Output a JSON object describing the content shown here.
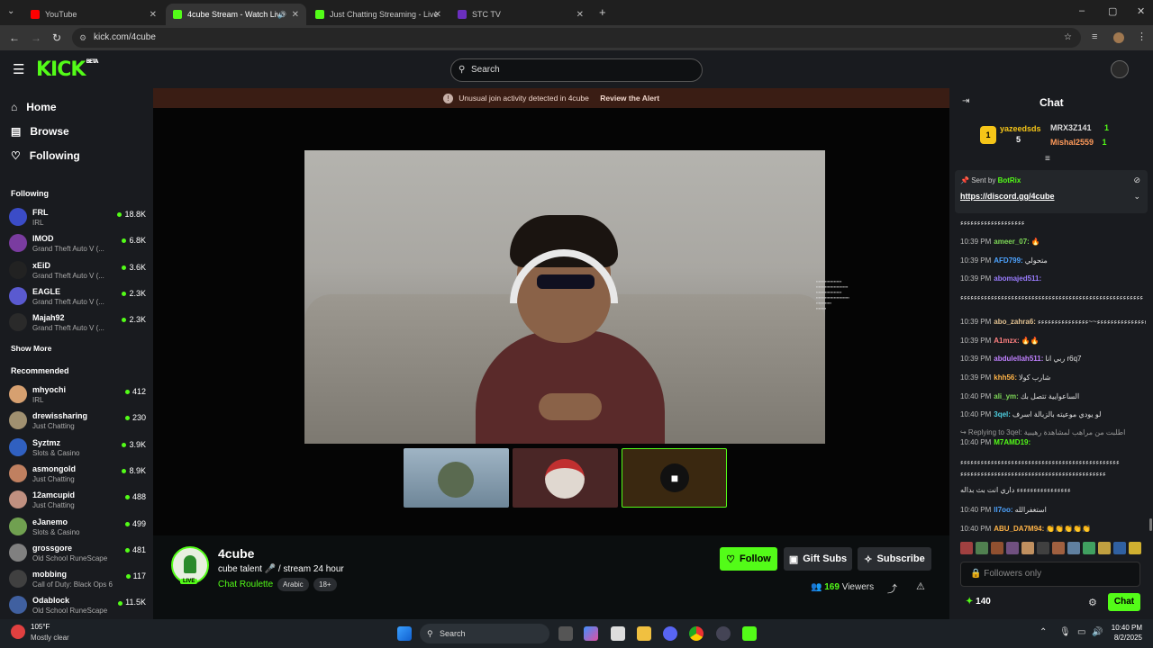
{
  "browser": {
    "tabs": [
      {
        "title": "YouTube",
        "color": "#ff0000"
      },
      {
        "title": "4cube Stream - Watch Live",
        "color": "#53fc18"
      },
      {
        "title": "Just Chatting Streaming - Live",
        "color": "#53fc18"
      },
      {
        "title": "STC TV",
        "color": "#6b2fbf"
      }
    ],
    "url": "kick.com/4cube"
  },
  "header": {
    "logo": "KICK",
    "logo_badge": "BETA",
    "search_placeholder": "Search"
  },
  "sidebar": {
    "nav": [
      "Home",
      "Browse",
      "Following"
    ],
    "following_title": "Following",
    "following": [
      {
        "name": "FRL",
        "category": "IRL",
        "viewers": "18.8K",
        "color": "#3b4cc7"
      },
      {
        "name": "IMOD",
        "category": "Grand Theft Auto V (...",
        "viewers": "6.8K",
        "color": "#7a3ca0"
      },
      {
        "name": "xEiD",
        "category": "Grand Theft Auto V (...",
        "viewers": "3.6K",
        "color": "#222"
      },
      {
        "name": "EAGLE",
        "category": "Grand Theft Auto V (...",
        "viewers": "2.3K",
        "color": "#5a5ad0"
      },
      {
        "name": "Majah92",
        "category": "Grand Theft Auto V (...",
        "viewers": "2.3K",
        "color": "#2a2a2a"
      }
    ],
    "show_more": "Show More",
    "recommended_title": "Recommended",
    "recommended": [
      {
        "name": "mhyochi",
        "category": "IRL",
        "viewers": "412",
        "color": "#d6a070"
      },
      {
        "name": "drewissharing",
        "category": "Just Chatting",
        "viewers": "230",
        "color": "#a09070"
      },
      {
        "name": "Syztmz",
        "category": "Slots & Casino",
        "viewers": "3.9K",
        "color": "#3060c0"
      },
      {
        "name": "asmongold",
        "category": "Just Chatting",
        "viewers": "8.9K",
        "color": "#c08060"
      },
      {
        "name": "12amcupid",
        "category": "Just Chatting",
        "viewers": "488",
        "color": "#c09080"
      },
      {
        "name": "eJanemo",
        "category": "Slots & Casino",
        "viewers": "499",
        "color": "#70a050"
      },
      {
        "name": "grossgore",
        "category": "Old School RuneScape",
        "viewers": "481",
        "color": "#808080"
      },
      {
        "name": "mobbing",
        "category": "Call of Duty: Black Ops 6",
        "viewers": "117",
        "color": "#404040"
      },
      {
        "name": "Odablock",
        "category": "Old School RuneScape",
        "viewers": "11.5K",
        "color": "#4060a0"
      }
    ]
  },
  "alert": {
    "text": "Unusual join activity detected in 4cube",
    "action": "Review the Alert"
  },
  "stream": {
    "channel": "4cube",
    "title": "cube talent 🎤 / stream 24 hour",
    "category": "Chat Roulette",
    "tags": [
      "Arabic",
      "18+"
    ],
    "live_badge": "LIVE",
    "viewers": "169",
    "viewers_label": "Viewers",
    "follow": "Follow",
    "gift": "Gift Subs",
    "subscribe": "Subscribe"
  },
  "chat": {
    "title": "Chat",
    "top_gifter": {
      "name": "yazeedsds",
      "count": "5"
    },
    "leaders": [
      {
        "name": "MRX3Z141",
        "count": "1"
      },
      {
        "name": "Mishal2559",
        "count": "1"
      }
    ],
    "pinned_sender_label": "Sent by",
    "pinned_sender": "BotRix",
    "pinned_link": "https://discord.gg/4cube",
    "messages": [
      {
        "time": "",
        "user": "",
        "text": "ءءءءءءءءءءءءءءءءءءء",
        "color": "#e0e0e0"
      },
      {
        "time": "10:39 PM",
        "user": "ameer_07:",
        "text": "🔥",
        "color": "#7ed957"
      },
      {
        "time": "10:39 PM",
        "user": "AFD799:",
        "text": "متحولي",
        "color": "#4da3ff"
      },
      {
        "time": "10:39 PM",
        "user": "abomajed511:",
        "text": "",
        "color": "#9a7cff"
      },
      {
        "time": "",
        "user": "",
        "text": "ءءءءءءءءءءءءءءءءءءءءءءءءءءءءءءءءءءءءءءءءءءءءءءءءءءءءءء",
        "color": "#e0e0e0"
      },
      {
        "time": "10:39 PM",
        "user": "abo_zahra6:",
        "text": "ءءءءءءءءءءءءءءءء~~ءءءءءءءءءءءءءءء",
        "color": "#e0c090"
      },
      {
        "time": "10:39 PM",
        "user": "A1mzx:",
        "text": "🔥🔥",
        "color": "#ff8080"
      },
      {
        "time": "10:39 PM",
        "user": "abdulellah511:",
        "text": "ربي انا r6q7",
        "color": "#c080ff"
      },
      {
        "time": "10:39 PM",
        "user": "khh56:",
        "text": "شارب كولا",
        "color": "#ffb347"
      },
      {
        "time": "10:40 PM",
        "user": "ali_ym:",
        "text": "الساعوايية تتصل بك",
        "color": "#7ed957"
      },
      {
        "time": "10:40 PM",
        "user": "3qel:",
        "text": "لو يودي موعيته بالزبالة اسرف",
        "color": "#4dd0e1"
      },
      {
        "time": "",
        "user": "",
        "text": "↪ Replying to 3qel: اطلبت من مراهب لمشاهدة رهيبية",
        "color": "#999"
      },
      {
        "time": "10:40 PM",
        "user": "M7AMD19:",
        "text": "",
        "color": "#53fc18"
      },
      {
        "time": "",
        "user": "",
        "text": "ءءءءءءءءءءءءءءءءءءءءءءءءءءءءءءءءءءءءءءءءءءءءءءء",
        "color": "#e0e0e0"
      },
      {
        "time": "",
        "user": "",
        "text": "ءءءءءءءءءءءءءءءءءءءءءءءءءءءءءءءءءءءءءءءءءءء",
        "color": "#e0e0e0"
      },
      {
        "time": "",
        "user": "",
        "text": "ءءءءءءءءءءءءءءءء داري انت بث بداله",
        "color": "#e0e0e0"
      },
      {
        "time": "10:40 PM",
        "user": "ll7oo:",
        "text": "استغفرالله",
        "color": "#4da3ff"
      },
      {
        "time": "10:40 PM",
        "user": "ABU_DA7M94:",
        "text": "👏👏👏👏👏",
        "color": "#ffb347"
      }
    ],
    "followers_only": "Followers only",
    "points": "140",
    "send": "Chat"
  },
  "taskbar": {
    "weather_temp": "105°F",
    "weather_desc": "Mostly clear",
    "search": "Search",
    "time": "10:40 PM",
    "date": "8/2/2025"
  }
}
